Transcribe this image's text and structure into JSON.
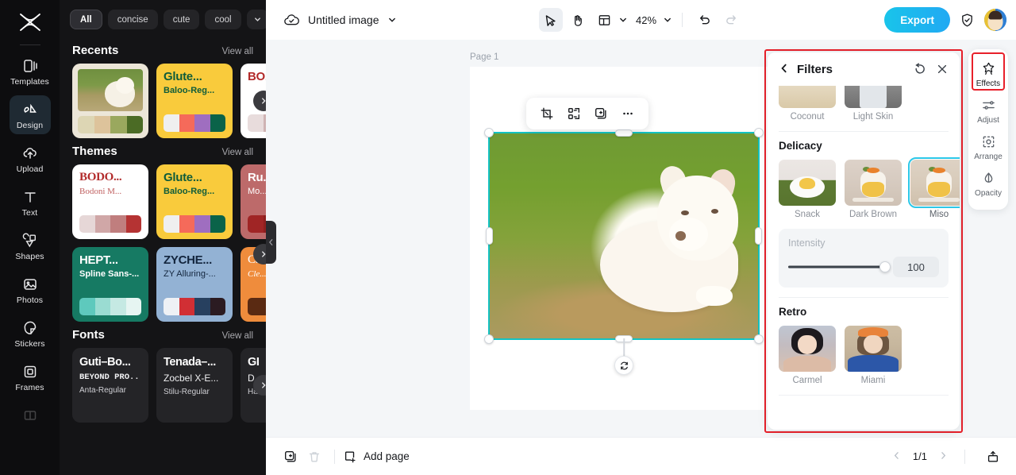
{
  "app": {
    "name": "CapCut Image Editor"
  },
  "left_rail": {
    "logo": "capcut-logo",
    "items": [
      {
        "label": "Templates",
        "icon": "templates-icon",
        "active": false
      },
      {
        "label": "Design",
        "icon": "design-icon",
        "active": true
      },
      {
        "label": "Upload",
        "icon": "upload-cloud-icon",
        "active": false
      },
      {
        "label": "Text",
        "icon": "text-icon",
        "active": false
      },
      {
        "label": "Shapes",
        "icon": "shapes-icon",
        "active": false
      },
      {
        "label": "Photos",
        "icon": "photos-icon",
        "active": false
      },
      {
        "label": "Stickers",
        "icon": "stickers-icon",
        "active": false
      },
      {
        "label": "Frames",
        "icon": "frames-icon",
        "active": false
      },
      {
        "label": "",
        "icon": "book-icon",
        "active": false
      }
    ]
  },
  "browser_panel": {
    "chips": [
      {
        "label": "All",
        "selected": true
      },
      {
        "label": "concise",
        "selected": false
      },
      {
        "label": "cute",
        "selected": false
      },
      {
        "label": "cool",
        "selected": false
      }
    ],
    "chip_more_icon": "chevron-down-icon",
    "sections": [
      {
        "title": "Recents",
        "view_all": "View all",
        "cards": [
          {
            "kind": "photo",
            "line1": "",
            "line2": "",
            "swatches": [
              "#ddd6b4",
              "#ddc39b",
              "#9aa85e",
              "#4b6b25"
            ]
          },
          {
            "kind": "text",
            "line1": "Glute...",
            "line2": "Baloo-Reg...",
            "bg": "#f9cb3c",
            "fg": "#0f5c3a",
            "swatches": [
              "#efefef",
              "#f56a5a",
              "#9f6ec0",
              "#0a6349"
            ]
          },
          {
            "kind": "text",
            "line1": "BO...",
            "line2": "",
            "bg": "#ffffff",
            "fg": "#b22a2a",
            "swatches": [
              "#e8dcdc",
              "#cfb3b3",
              "#bf8a8a",
              "#a64141"
            ]
          }
        ]
      },
      {
        "title": "Themes",
        "view_all": "View all",
        "cards": [
          {
            "kind": "text",
            "line1": "BODO...",
            "line2": "Bodoni M...",
            "bg": "#ffffff",
            "fg": "#b22a2a",
            "swatches": [
              "#e6d7d7",
              "#d0a7a7",
              "#c07e7e",
              "#b53333"
            ]
          },
          {
            "kind": "text",
            "line1": "Glute...",
            "line2": "Baloo-Reg...",
            "bg": "#f9cb3c",
            "fg": "#0f5c3a",
            "swatches": [
              "#efefef",
              "#f56a5a",
              "#9f6ec0",
              "#0a6349"
            ]
          },
          {
            "kind": "text",
            "line1": "Ru...",
            "line2": "Mo...",
            "bg": "#bd6a6a",
            "fg": "#ffffff",
            "swatches": [
              "#a02525",
              "#8e1f1f",
              "#7a1a1a",
              "#6b1616"
            ]
          },
          {
            "kind": "text",
            "line1": "HEPT...",
            "line2": "Spline Sans-...",
            "bg": "#167a63",
            "fg": "#ffffff",
            "swatches": [
              "#5ec9bd",
              "#9adcd2",
              "#c5e9e3",
              "#e6f5f2"
            ]
          },
          {
            "kind": "text",
            "line1": "ZYCHE...",
            "line2": "ZY Alluring-...",
            "bg": "#93b2d4",
            "fg": "#13253d",
            "swatches": [
              "#eef1f5",
              "#d12f34",
              "#27405f",
              "#2b1b22"
            ]
          },
          {
            "kind": "text",
            "line1": "Ca...",
            "line2": "Cle...",
            "bg": "#ef8c3c",
            "fg": "#ffffff",
            "swatches": [
              "#5a2a12",
              "#5a2a12",
              "#5a2a12",
              "#5a2a12"
            ]
          }
        ]
      },
      {
        "title": "Fonts",
        "view_all": "View all",
        "cards": [
          {
            "kind": "font",
            "line1": "Guti–Bo...",
            "line2": "BEYOND PRO...",
            "line3": "Anta-Regular"
          },
          {
            "kind": "font",
            "line1": "Tenada–...",
            "line2": "Zocbel X-E...",
            "line3": "Stilu-Regular"
          },
          {
            "kind": "font",
            "line1": "GI",
            "line2": "D",
            "line3": "Ham"
          }
        ]
      }
    ],
    "next_arrow_icon": "chevron-right-icon",
    "collapse_icon": "chevron-left-icon"
  },
  "topbar": {
    "cloud_icon": "cloud-saved-icon",
    "doc_title": "Untitled image",
    "doc_title_caret_icon": "chevron-down-icon",
    "tools": [
      {
        "name": "select-tool",
        "icon": "cursor-arrow-icon",
        "active": true
      },
      {
        "name": "hand-tool",
        "icon": "hand-icon",
        "active": false
      },
      {
        "name": "layout-tool",
        "icon": "layout-grid-icon",
        "active": false
      }
    ],
    "layout_caret_icon": "chevron-down-icon",
    "zoom_level": "42%",
    "zoom_caret_icon": "chevron-down-icon",
    "undo_icon": "undo-icon",
    "redo_icon": "redo-icon",
    "export_label": "Export",
    "shield_icon": "shield-check-icon",
    "avatar": "user-avatar"
  },
  "canvas": {
    "page_label": "Page 1",
    "image_alt": "white samoyed puppy lying on grass",
    "float_tools": [
      {
        "name": "crop-button",
        "icon": "crop-icon"
      },
      {
        "name": "remove-bg-button",
        "icon": "cutout-icon"
      },
      {
        "name": "duplicate-button",
        "icon": "duplicate-icon"
      },
      {
        "name": "more-button",
        "icon": "more-horizontal-icon"
      }
    ],
    "rotate_icon": "rotate-icon",
    "selection_color": "#13c2c2"
  },
  "bottombar": {
    "duplicate_page_icon": "duplicate-page-icon",
    "delete_page_icon": "trash-icon",
    "add_page_icon": "add-page-icon",
    "add_page_label": "Add page",
    "prev_icon": "chevron-left-icon",
    "page_indicator": "1/1",
    "next_icon": "chevron-right-icon",
    "present_icon": "present-icon"
  },
  "filters_panel": {
    "back_icon": "chevron-left-icon",
    "title": "Filters",
    "reset_icon": "reset-icon",
    "close_icon": "close-icon",
    "highlight_color": "#e8202a",
    "selected_outline_color": "#2dc8e8",
    "top_partial_row": [
      {
        "label": "Coconut",
        "art": "t-coconut",
        "selected": false
      },
      {
        "label": "Light Skin",
        "art": "t-lightskin",
        "selected": false
      }
    ],
    "groups": [
      {
        "title": "Delicacy",
        "items": [
          {
            "label": "Snack",
            "art": "t-snack",
            "selected": false
          },
          {
            "label": "Dark Brown",
            "art": "t-darkbrown",
            "selected": false
          },
          {
            "label": "Miso",
            "art": "t-miso",
            "selected": true
          }
        ],
        "intensity": {
          "label": "Intensity",
          "value": "100",
          "percent": 100
        }
      },
      {
        "title": "Retro",
        "items": [
          {
            "label": "Carmel",
            "art": "t-carmel",
            "selected": false
          },
          {
            "label": "Miami",
            "art": "t-miami",
            "selected": false
          }
        ]
      }
    ]
  },
  "tool_rail": {
    "highlight_color": "#e8202a",
    "items": [
      {
        "label": "Effects",
        "icon": "effects-sparkle-icon",
        "active": true
      },
      {
        "label": "Adjust",
        "icon": "adjust-sliders-icon",
        "active": false
      },
      {
        "label": "Arrange",
        "icon": "arrange-icon",
        "active": false
      },
      {
        "label": "Opacity",
        "icon": "opacity-droplet-icon",
        "active": false
      }
    ]
  }
}
